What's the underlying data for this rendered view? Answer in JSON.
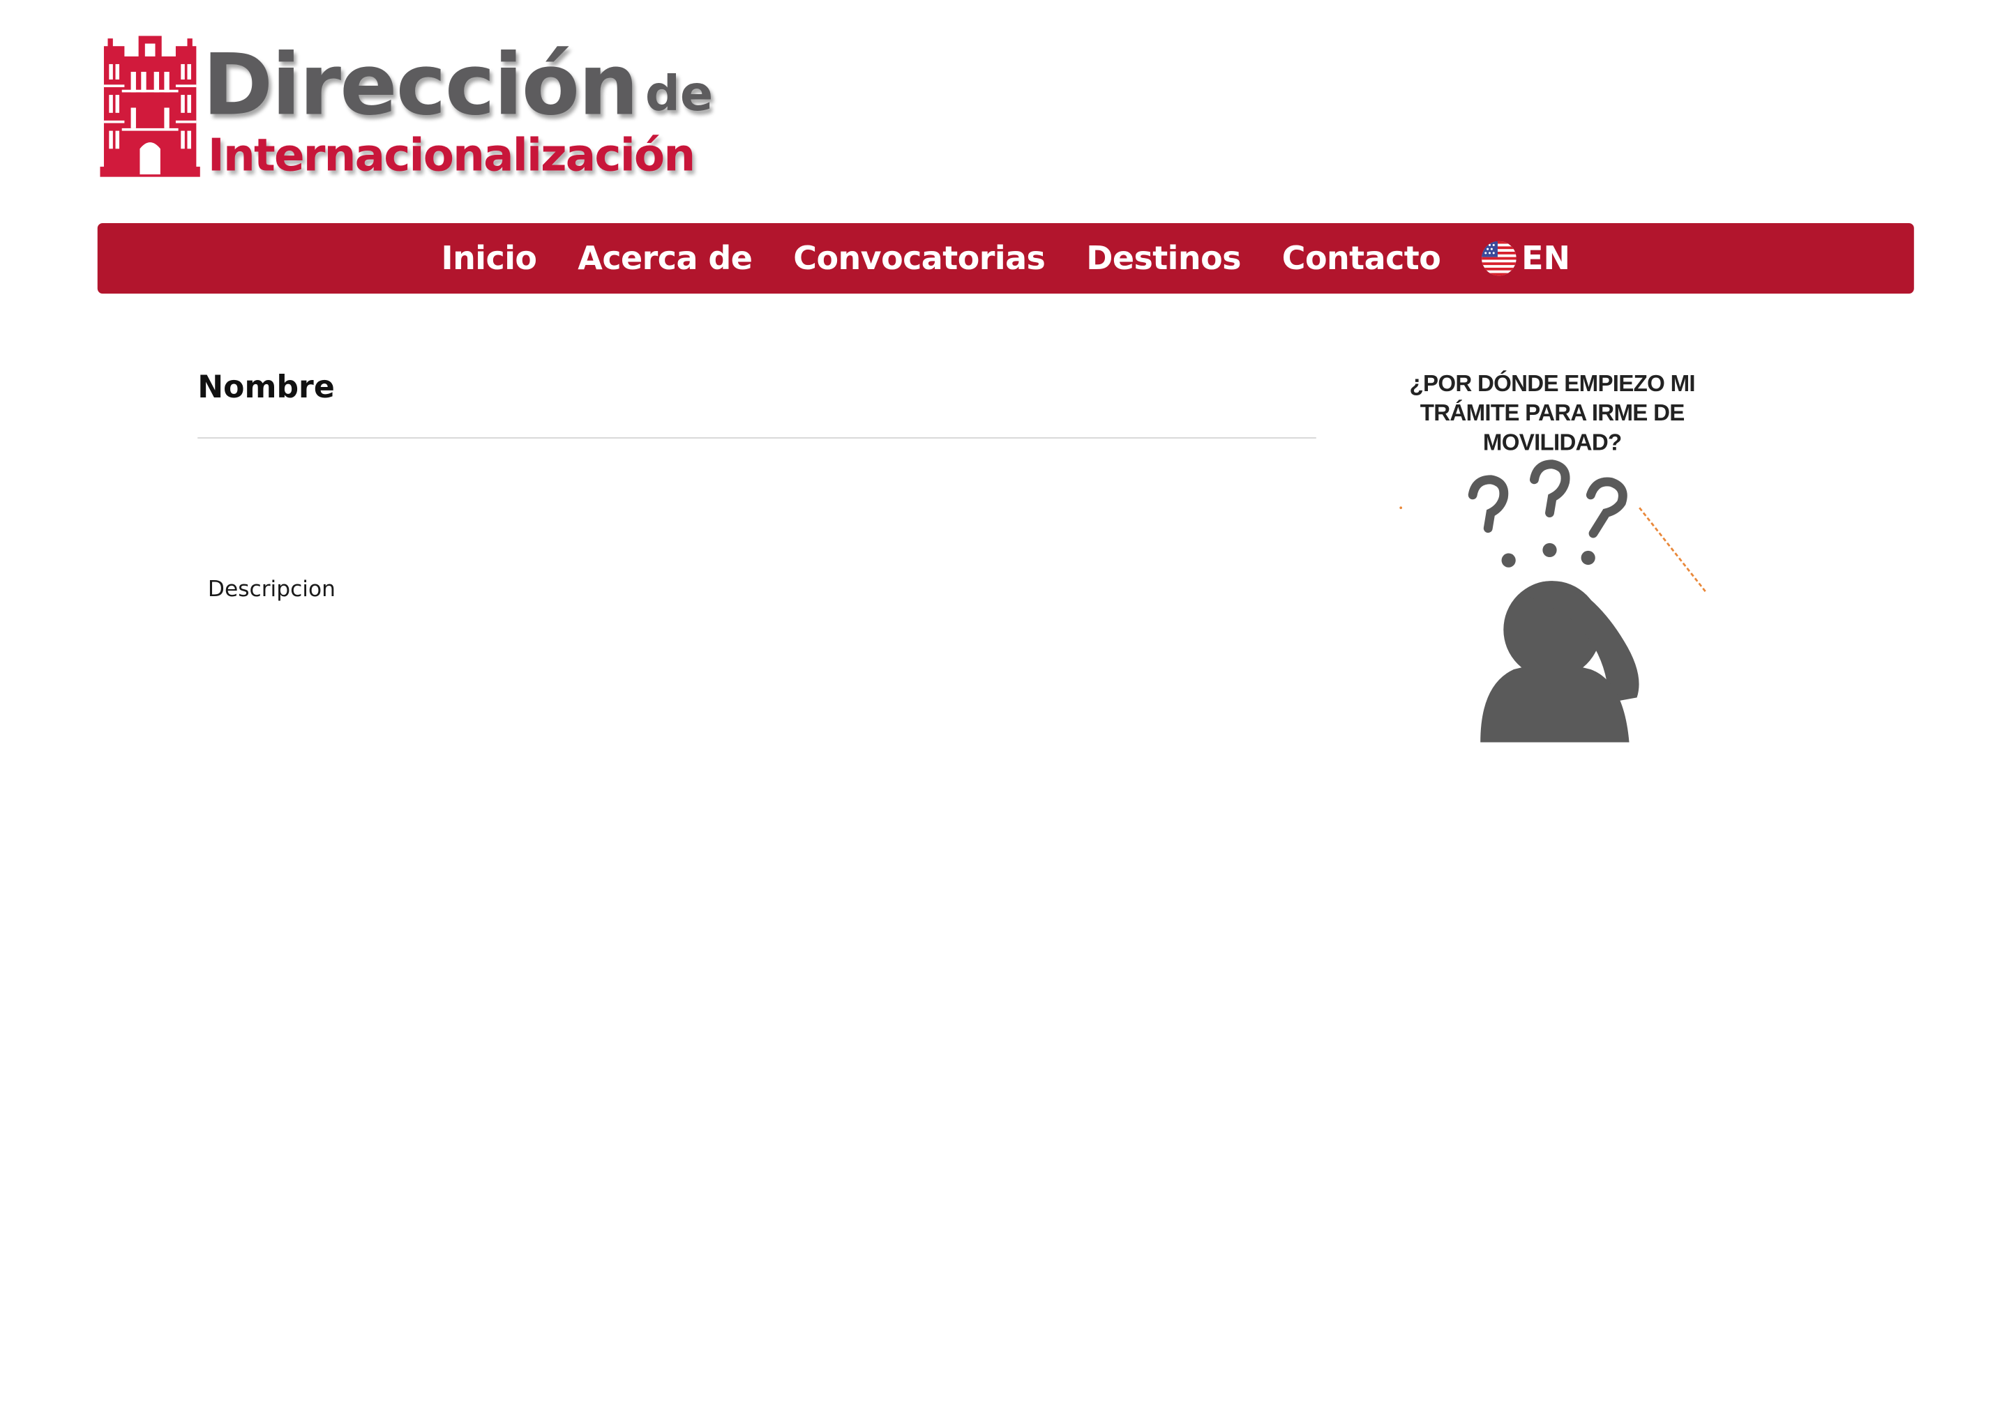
{
  "header": {
    "logo_word_main": "Dirección",
    "logo_word_de": "de",
    "logo_word_bottom": "Internacionalización"
  },
  "nav": {
    "items": [
      {
        "label": "Inicio"
      },
      {
        "label": "Acerca de"
      },
      {
        "label": "Convocatorias"
      },
      {
        "label": "Destinos"
      },
      {
        "label": "Contacto"
      }
    ],
    "language_label": "EN",
    "language_icon": "us-flag-icon",
    "background_color": "#b2152d"
  },
  "main": {
    "title": "Nombre",
    "description": "Descripcion"
  },
  "sidebar": {
    "image_caption": "¿POR DÓNDE EMPIEZO MI TRÁMITE PARA IRME DE MOVILIDAD?"
  },
  "colors": {
    "brand_red": "#b2152d",
    "logo_red": "#c8163a",
    "logo_gray": "#5d5c5e"
  }
}
